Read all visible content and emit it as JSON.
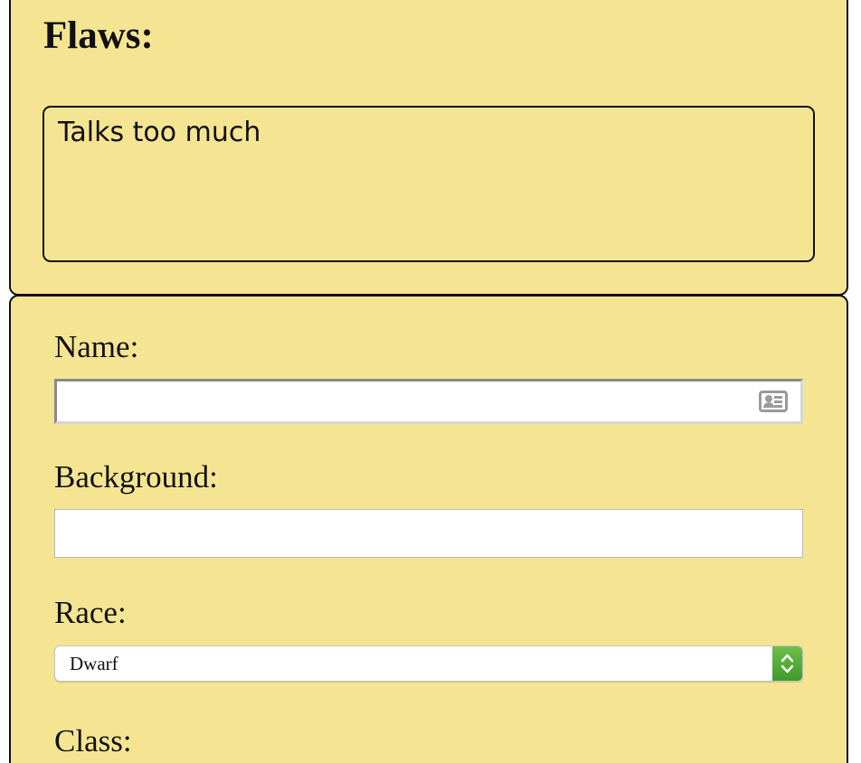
{
  "flaws": {
    "heading": "Flaws:",
    "text": "Talks too much"
  },
  "character": {
    "name": {
      "label": "Name:",
      "value": "",
      "icon": "contact-card-icon"
    },
    "background": {
      "label": "Background:",
      "value": ""
    },
    "race": {
      "label": "Race:",
      "selected": "Dwarf",
      "icon": "select-up-down-arrows-icon"
    },
    "class": {
      "label": "Class:"
    }
  },
  "colors": {
    "panel_background": "#f5e593",
    "panel_border": "#111111",
    "select_accent": "#4caa32"
  }
}
